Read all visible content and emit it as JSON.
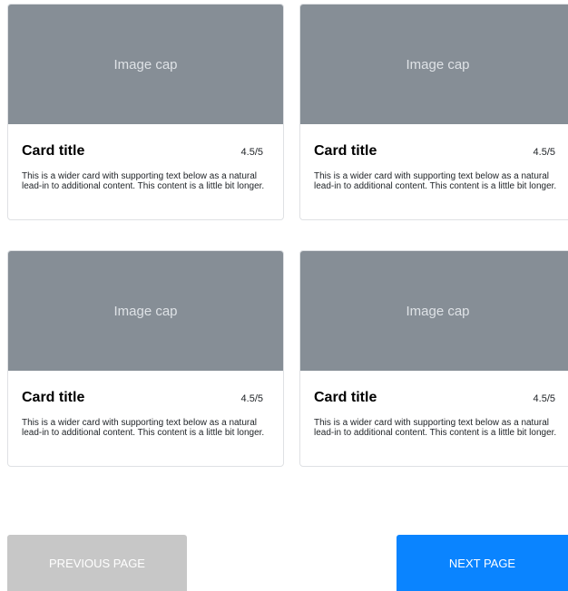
{
  "cards": [
    {
      "image_label": "Image cap",
      "title": "Card title",
      "rating": "4.5/5",
      "text": "This is a wider card with supporting text below as a natural lead-in to additional content. This content is a little bit longer."
    },
    {
      "image_label": "Image cap",
      "title": "Card title",
      "rating": "4.5/5",
      "text": "This is a wider card with supporting text below as a natural lead-in to additional content. This content is a little bit longer."
    },
    {
      "image_label": "Image cap",
      "title": "Card title",
      "rating": "4.5/5",
      "text": "This is a wider card with supporting text below as a natural lead-in to additional content. This content is a little bit longer."
    },
    {
      "image_label": "Image cap",
      "title": "Card title",
      "rating": "4.5/5",
      "text": "This is a wider card with supporting text below as a natural lead-in to additional content. This content is a little bit longer."
    }
  ],
  "pagination": {
    "prev_label": "PREVIOUS PAGE",
    "next_label": "NEXT PAGE"
  },
  "colors": {
    "image_placeholder": "#868e96",
    "prev_button": "#c7c7c7",
    "next_button": "#0a84ff"
  }
}
